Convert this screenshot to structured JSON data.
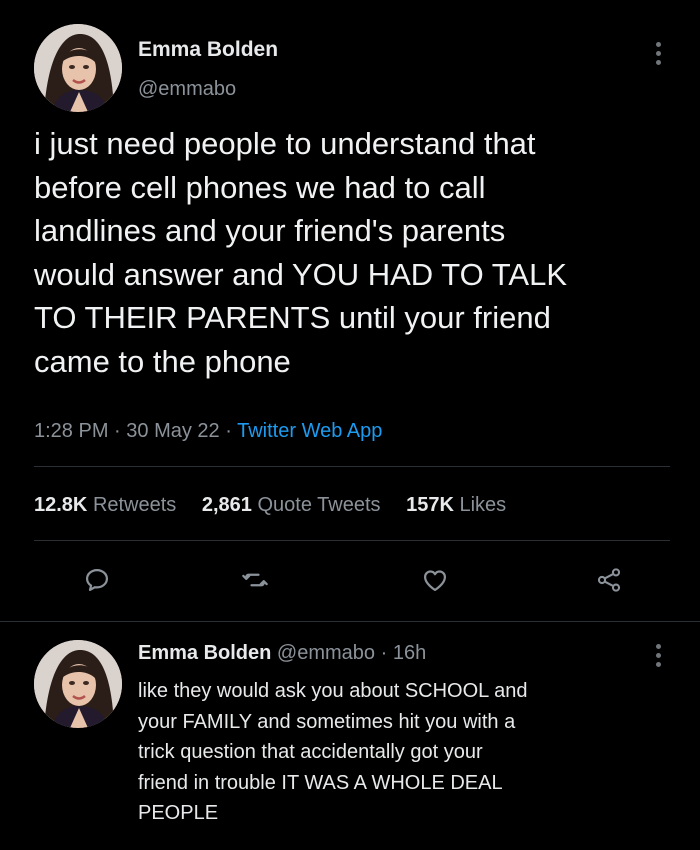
{
  "tweet": {
    "author_name": "Emma Bolden",
    "author_handle": "@emmabo",
    "text": "i just need people to understand that\nbefore cell phones we had to call\nlandlines and your friend's parents\nwould answer and YOU HAD TO TALK\nTO THEIR PARENTS until your friend\ncame to the phone",
    "time": "1:28 PM",
    "date": "30 May 22",
    "separator": "·",
    "source": "Twitter Web App"
  },
  "stats": {
    "retweets_count": "12.8K",
    "retweets_label": "Retweets",
    "quotes_count": "2,861",
    "quotes_label": "Quote Tweets",
    "likes_count": "157K",
    "likes_label": "Likes"
  },
  "actions": {
    "reply_icon": "speech-bubble-icon",
    "retweet_icon": "retweet-arrows-icon",
    "like_icon": "heart-icon",
    "share_icon": "share-nodes-icon"
  },
  "reply": {
    "author_name": "Emma Bolden",
    "author_handle": "@emmabo",
    "separator": "·",
    "age": "16h",
    "text": "like they would ask you about SCHOOL and\nyour FAMILY and sometimes hit you with a\ntrick question that accidentally got your\nfriend in trouble IT WAS A WHOLE DEAL\nPEOPLE"
  },
  "colors": {
    "background": "#000000",
    "text": "#e7e9ea",
    "secondary": "#8b9299",
    "accent": "#1d9bf0",
    "divider": "#2a2f33"
  }
}
